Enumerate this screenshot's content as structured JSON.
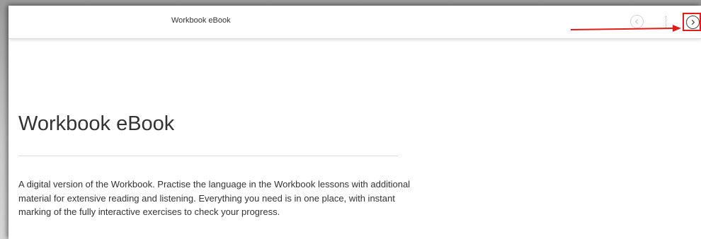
{
  "header": {
    "title": "Workbook eBook"
  },
  "nav": {
    "prev_icon": "chevron-left-circle-icon",
    "next_icon": "chevron-right-circle-icon"
  },
  "annotation": {
    "color": "#e21b1b"
  },
  "main": {
    "title": "Workbook eBook",
    "description": "A digital version of the Workbook. Practise the language in the Workbook lessons with additional material for extensive reading and listening. Everything you need is in one place, with instant marking of the fully interactive exercises to check your progress."
  }
}
